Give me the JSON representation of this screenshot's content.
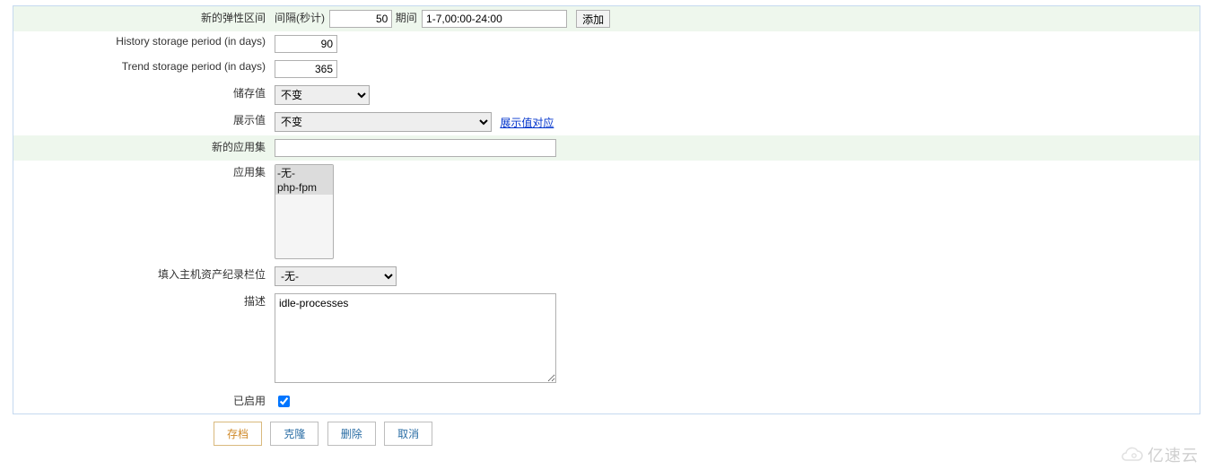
{
  "rows": {
    "elastic_interval": {
      "label": "新的弹性区间",
      "interval_label": "间隔(秒计)",
      "interval_value": "50",
      "period_label": "期间",
      "period_value": "1-7,00:00-24:00",
      "add_button": "添加"
    },
    "history_period": {
      "label": "History storage period (in days)",
      "value": "90"
    },
    "trend_period": {
      "label": "Trend storage period (in days)",
      "value": "365"
    },
    "store_value": {
      "label": "储存值",
      "selected": "不变",
      "options": [
        "不变"
      ]
    },
    "show_value": {
      "label": "展示值",
      "selected": "不变",
      "options": [
        "不变"
      ],
      "link_text": "展示值对应"
    },
    "new_appset": {
      "label": "新的应用集",
      "value": ""
    },
    "appset": {
      "label": "应用集",
      "options": [
        "-无-",
        "php-fpm"
      ]
    },
    "host_inventory": {
      "label": "填入主机资产纪录栏位",
      "selected": "-无-",
      "options": [
        "-无-"
      ]
    },
    "description": {
      "label": "描述",
      "value": "idle-processes"
    },
    "enabled": {
      "label": "已启用",
      "checked": true
    }
  },
  "actions": {
    "save": "存档",
    "clone": "克隆",
    "delete": "删除",
    "cancel": "取消"
  },
  "watermark": "亿速云"
}
